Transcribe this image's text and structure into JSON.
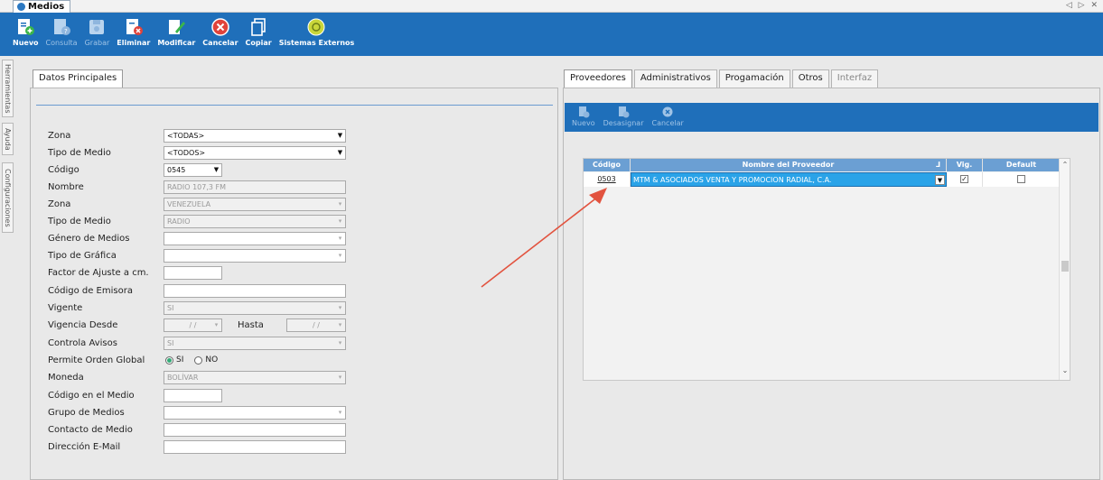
{
  "window": {
    "doc_tab_title": "Medios",
    "controls": "◁ ▷ ✕"
  },
  "toolbar": {
    "buttons": [
      {
        "label": "Nuevo",
        "icon": "new-doc-icon",
        "enabled": true
      },
      {
        "label": "Consulta",
        "icon": "query-icon",
        "enabled": false
      },
      {
        "label": "Grabar",
        "icon": "save-icon",
        "enabled": false
      },
      {
        "label": "Eliminar",
        "icon": "delete-icon",
        "enabled": true
      },
      {
        "label": "Modificar",
        "icon": "edit-icon",
        "enabled": true
      },
      {
        "label": "Cancelar",
        "icon": "cancel-icon",
        "enabled": true
      },
      {
        "label": "Copiar",
        "icon": "copy-icon",
        "enabled": true
      },
      {
        "label": "Sistemas Externos",
        "icon": "external-systems-icon",
        "enabled": true
      }
    ]
  },
  "side_tabs": [
    "Herramientas",
    "Ayuda",
    "Configuraciones"
  ],
  "left_panel": {
    "tab": "Datos Principales",
    "fields": {
      "zona": {
        "label": "Zona",
        "value": "<TODAS>"
      },
      "tipo_medio": {
        "label": "Tipo de Medio",
        "value": "<TODOS>"
      },
      "codigo": {
        "label": "Código",
        "value": "0545"
      },
      "nombre": {
        "label": "Nombre",
        "value": "RADIO 107,3 FM"
      },
      "zona2": {
        "label": "Zona",
        "value": "VENEZUELA"
      },
      "tipo_medio2": {
        "label": "Tipo de Medio",
        "value": "RADIO"
      },
      "genero": {
        "label": "Género de Medios",
        "value": ""
      },
      "tipo_grafica": {
        "label": "Tipo de Gráfica",
        "value": ""
      },
      "factor": {
        "label": "Factor de Ajuste a cm.",
        "value": ""
      },
      "codigo_emisora": {
        "label": "Código de Emisora",
        "value": ""
      },
      "vigente": {
        "label": "Vigente",
        "value": "SI"
      },
      "vigencia_desde": {
        "label": "Vigencia Desde",
        "value": "/ /"
      },
      "hasta": {
        "label": "Hasta",
        "value": "/ /"
      },
      "controla_avisos": {
        "label": "Controla Avisos",
        "value": "SI"
      },
      "permite_orden": {
        "label": "Permite Orden Global",
        "opt_si": "SI",
        "opt_no": "NO"
      },
      "moneda": {
        "label": "Moneda",
        "value": "BOLÍVAR"
      },
      "codigo_medio": {
        "label": "Código en el Medio",
        "value": ""
      },
      "grupo_medios": {
        "label": "Grupo de Medios",
        "value": ""
      },
      "contacto": {
        "label": "Contacto de Medio",
        "value": ""
      },
      "email": {
        "label": "Dirección E-Mail",
        "value": ""
      }
    }
  },
  "right_panel": {
    "tabs": [
      {
        "label": "Proveedores",
        "active": true
      },
      {
        "label": "Administrativos",
        "active": false
      },
      {
        "label": "Progamación",
        "active": false
      },
      {
        "label": "Otros",
        "active": false
      },
      {
        "label": "Interfaz",
        "active": false
      }
    ],
    "sub_toolbar": [
      "Nuevo",
      "Desasignar",
      "Cancelar"
    ],
    "grid": {
      "columns": [
        "Código",
        "Nombre del Proveedor",
        "Vig.",
        "Default"
      ],
      "rows": [
        {
          "codigo": "0503",
          "nombre": "MTM & ASOCIADOS VENTA Y PROMOCION RADIAL, C.A.",
          "vig": true,
          "default": false
        }
      ]
    }
  },
  "colors": {
    "toolbar_blue": "#1f6fba",
    "grid_header": "#6b9fd3",
    "arrow_red": "#e2533f"
  }
}
